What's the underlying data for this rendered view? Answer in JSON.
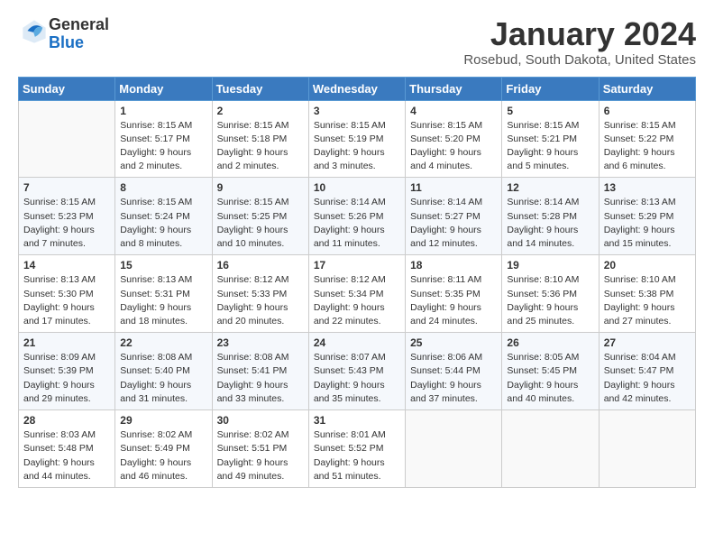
{
  "logo": {
    "text_general": "General",
    "text_blue": "Blue"
  },
  "header": {
    "title": "January 2024",
    "subtitle": "Rosebud, South Dakota, United States"
  },
  "weekdays": [
    "Sunday",
    "Monday",
    "Tuesday",
    "Wednesday",
    "Thursday",
    "Friday",
    "Saturday"
  ],
  "weeks": [
    [
      {
        "day": "",
        "sunrise": "",
        "sunset": "",
        "daylight": ""
      },
      {
        "day": "1",
        "sunrise": "Sunrise: 8:15 AM",
        "sunset": "Sunset: 5:17 PM",
        "daylight": "Daylight: 9 hours and 2 minutes."
      },
      {
        "day": "2",
        "sunrise": "Sunrise: 8:15 AM",
        "sunset": "Sunset: 5:18 PM",
        "daylight": "Daylight: 9 hours and 2 minutes."
      },
      {
        "day": "3",
        "sunrise": "Sunrise: 8:15 AM",
        "sunset": "Sunset: 5:19 PM",
        "daylight": "Daylight: 9 hours and 3 minutes."
      },
      {
        "day": "4",
        "sunrise": "Sunrise: 8:15 AM",
        "sunset": "Sunset: 5:20 PM",
        "daylight": "Daylight: 9 hours and 4 minutes."
      },
      {
        "day": "5",
        "sunrise": "Sunrise: 8:15 AM",
        "sunset": "Sunset: 5:21 PM",
        "daylight": "Daylight: 9 hours and 5 minutes."
      },
      {
        "day": "6",
        "sunrise": "Sunrise: 8:15 AM",
        "sunset": "Sunset: 5:22 PM",
        "daylight": "Daylight: 9 hours and 6 minutes."
      }
    ],
    [
      {
        "day": "7",
        "sunrise": "Sunrise: 8:15 AM",
        "sunset": "Sunset: 5:23 PM",
        "daylight": "Daylight: 9 hours and 7 minutes."
      },
      {
        "day": "8",
        "sunrise": "Sunrise: 8:15 AM",
        "sunset": "Sunset: 5:24 PM",
        "daylight": "Daylight: 9 hours and 8 minutes."
      },
      {
        "day": "9",
        "sunrise": "Sunrise: 8:15 AM",
        "sunset": "Sunset: 5:25 PM",
        "daylight": "Daylight: 9 hours and 10 minutes."
      },
      {
        "day": "10",
        "sunrise": "Sunrise: 8:14 AM",
        "sunset": "Sunset: 5:26 PM",
        "daylight": "Daylight: 9 hours and 11 minutes."
      },
      {
        "day": "11",
        "sunrise": "Sunrise: 8:14 AM",
        "sunset": "Sunset: 5:27 PM",
        "daylight": "Daylight: 9 hours and 12 minutes."
      },
      {
        "day": "12",
        "sunrise": "Sunrise: 8:14 AM",
        "sunset": "Sunset: 5:28 PM",
        "daylight": "Daylight: 9 hours and 14 minutes."
      },
      {
        "day": "13",
        "sunrise": "Sunrise: 8:13 AM",
        "sunset": "Sunset: 5:29 PM",
        "daylight": "Daylight: 9 hours and 15 minutes."
      }
    ],
    [
      {
        "day": "14",
        "sunrise": "Sunrise: 8:13 AM",
        "sunset": "Sunset: 5:30 PM",
        "daylight": "Daylight: 9 hours and 17 minutes."
      },
      {
        "day": "15",
        "sunrise": "Sunrise: 8:13 AM",
        "sunset": "Sunset: 5:31 PM",
        "daylight": "Daylight: 9 hours and 18 minutes."
      },
      {
        "day": "16",
        "sunrise": "Sunrise: 8:12 AM",
        "sunset": "Sunset: 5:33 PM",
        "daylight": "Daylight: 9 hours and 20 minutes."
      },
      {
        "day": "17",
        "sunrise": "Sunrise: 8:12 AM",
        "sunset": "Sunset: 5:34 PM",
        "daylight": "Daylight: 9 hours and 22 minutes."
      },
      {
        "day": "18",
        "sunrise": "Sunrise: 8:11 AM",
        "sunset": "Sunset: 5:35 PM",
        "daylight": "Daylight: 9 hours and 24 minutes."
      },
      {
        "day": "19",
        "sunrise": "Sunrise: 8:10 AM",
        "sunset": "Sunset: 5:36 PM",
        "daylight": "Daylight: 9 hours and 25 minutes."
      },
      {
        "day": "20",
        "sunrise": "Sunrise: 8:10 AM",
        "sunset": "Sunset: 5:38 PM",
        "daylight": "Daylight: 9 hours and 27 minutes."
      }
    ],
    [
      {
        "day": "21",
        "sunrise": "Sunrise: 8:09 AM",
        "sunset": "Sunset: 5:39 PM",
        "daylight": "Daylight: 9 hours and 29 minutes."
      },
      {
        "day": "22",
        "sunrise": "Sunrise: 8:08 AM",
        "sunset": "Sunset: 5:40 PM",
        "daylight": "Daylight: 9 hours and 31 minutes."
      },
      {
        "day": "23",
        "sunrise": "Sunrise: 8:08 AM",
        "sunset": "Sunset: 5:41 PM",
        "daylight": "Daylight: 9 hours and 33 minutes."
      },
      {
        "day": "24",
        "sunrise": "Sunrise: 8:07 AM",
        "sunset": "Sunset: 5:43 PM",
        "daylight": "Daylight: 9 hours and 35 minutes."
      },
      {
        "day": "25",
        "sunrise": "Sunrise: 8:06 AM",
        "sunset": "Sunset: 5:44 PM",
        "daylight": "Daylight: 9 hours and 37 minutes."
      },
      {
        "day": "26",
        "sunrise": "Sunrise: 8:05 AM",
        "sunset": "Sunset: 5:45 PM",
        "daylight": "Daylight: 9 hours and 40 minutes."
      },
      {
        "day": "27",
        "sunrise": "Sunrise: 8:04 AM",
        "sunset": "Sunset: 5:47 PM",
        "daylight": "Daylight: 9 hours and 42 minutes."
      }
    ],
    [
      {
        "day": "28",
        "sunrise": "Sunrise: 8:03 AM",
        "sunset": "Sunset: 5:48 PM",
        "daylight": "Daylight: 9 hours and 44 minutes."
      },
      {
        "day": "29",
        "sunrise": "Sunrise: 8:02 AM",
        "sunset": "Sunset: 5:49 PM",
        "daylight": "Daylight: 9 hours and 46 minutes."
      },
      {
        "day": "30",
        "sunrise": "Sunrise: 8:02 AM",
        "sunset": "Sunset: 5:51 PM",
        "daylight": "Daylight: 9 hours and 49 minutes."
      },
      {
        "day": "31",
        "sunrise": "Sunrise: 8:01 AM",
        "sunset": "Sunset: 5:52 PM",
        "daylight": "Daylight: 9 hours and 51 minutes."
      },
      {
        "day": "",
        "sunrise": "",
        "sunset": "",
        "daylight": ""
      },
      {
        "day": "",
        "sunrise": "",
        "sunset": "",
        "daylight": ""
      },
      {
        "day": "",
        "sunrise": "",
        "sunset": "",
        "daylight": ""
      }
    ]
  ]
}
